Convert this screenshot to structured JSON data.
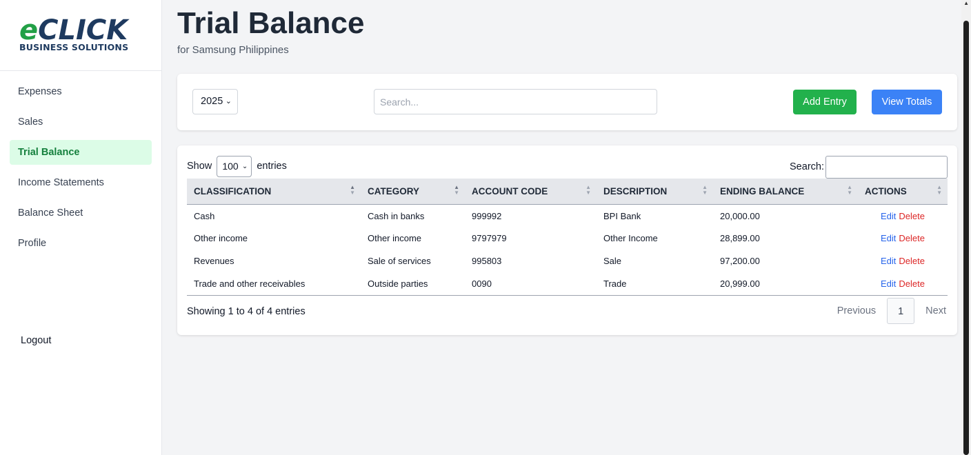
{
  "brand": {
    "logo_e": "e",
    "logo_rest": "CLICK",
    "logo_sub": "BUSINESS SOLUTIONS",
    "colors": {
      "green": "#22a046",
      "navy": "#1e3a5f"
    }
  },
  "sidebar": {
    "items": [
      {
        "label": "Expenses",
        "active": false
      },
      {
        "label": "Sales",
        "active": false
      },
      {
        "label": "Trial Balance",
        "active": true
      },
      {
        "label": "Income Statements",
        "active": false
      },
      {
        "label": "Balance Sheet",
        "active": false
      },
      {
        "label": "Profile",
        "active": false
      }
    ],
    "logout_label": "Logout"
  },
  "header": {
    "title": "Trial Balance",
    "subtitle": "for Samsung Philippines"
  },
  "toolbar": {
    "year_selected": "2025",
    "search_placeholder": "Search...",
    "add_label": "Add Entry",
    "view_totals_label": "View Totals",
    "add_color": "#22b14c",
    "view_color": "#3b82f6"
  },
  "table": {
    "show_label": "Show",
    "entries_label": "entries",
    "page_length": "100",
    "search_label": "Search:",
    "columns": [
      "CLASSIFICATION",
      "CATEGORY",
      "ACCOUNT CODE",
      "DESCRIPTION",
      "ENDING BALANCE",
      "ACTIONS"
    ],
    "rows": [
      {
        "classification": "Cash",
        "category": "Cash in banks",
        "account_code": "999992",
        "description": "BPI Bank",
        "ending_balance": "20,000.00"
      },
      {
        "classification": "Other income",
        "category": "Other income",
        "account_code": "9797979",
        "description": "Other Income",
        "ending_balance": "28,899.00"
      },
      {
        "classification": "Revenues",
        "category": "Sale of services",
        "account_code": "995803",
        "description": "Sale",
        "ending_balance": "97,200.00"
      },
      {
        "classification": "Trade and other receivables",
        "category": "Outside parties",
        "account_code": "0090",
        "description": "Trade",
        "ending_balance": "20,999.00"
      }
    ],
    "edit_label": "Edit",
    "delete_label": "Delete",
    "info": "Showing 1 to 4 of 4 entries",
    "pagination": {
      "previous": "Previous",
      "current": "1",
      "next": "Next"
    }
  }
}
